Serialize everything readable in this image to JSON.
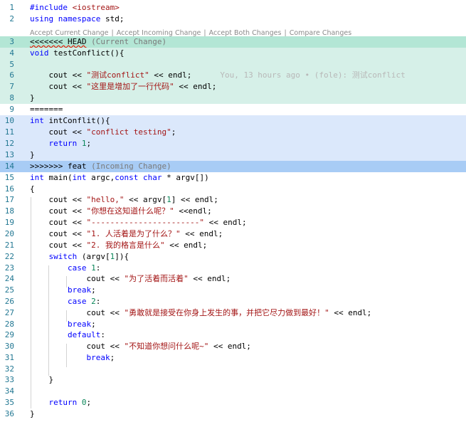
{
  "codelens": {
    "accept_current": "Accept Current Change",
    "accept_incoming": "Accept Incoming Change",
    "accept_both": "Accept Both Changes",
    "compare": "Compare Changes",
    "separator": "|"
  },
  "lines": [
    {
      "n": "1",
      "kind": "normal",
      "tokens": [
        [
          "dir",
          "#include "
        ],
        [
          "str",
          "<iostream>"
        ]
      ]
    },
    {
      "n": "2",
      "kind": "normal",
      "tokens": [
        [
          "kw",
          "using"
        ],
        [
          "",
          " "
        ],
        [
          "kw",
          "namespace"
        ],
        [
          "",
          " std;"
        ]
      ]
    },
    {
      "n": "3",
      "kind": "current-marker",
      "tokens": [
        [
          "squiggle",
          "<<<<<<< HEAD"
        ],
        [
          "muted",
          " (Current Change)"
        ]
      ]
    },
    {
      "n": "4",
      "kind": "current",
      "tokens": [
        [
          "kw",
          "void"
        ],
        [
          "",
          " testConflict(){"
        ]
      ]
    },
    {
      "n": "5",
      "kind": "current",
      "tokens": []
    },
    {
      "n": "6",
      "kind": "current",
      "tokens": [
        [
          "",
          "    cout << "
        ],
        [
          "str",
          "\"测试conflict\""
        ],
        [
          "",
          " << endl;"
        ]
      ],
      "blame": "You, 13 hours ago • (fole): 测试conflict"
    },
    {
      "n": "7",
      "kind": "current",
      "tokens": [
        [
          "",
          "    cout << "
        ],
        [
          "str",
          "\"这里是增加了一行代码\""
        ],
        [
          "",
          " << endl;"
        ]
      ]
    },
    {
      "n": "8",
      "kind": "current",
      "tokens": [
        [
          "",
          "}"
        ]
      ]
    },
    {
      "n": "9",
      "kind": "normal",
      "tokens": [
        [
          "",
          "======="
        ]
      ]
    },
    {
      "n": "10",
      "kind": "incoming",
      "tokens": [
        [
          "kw",
          "int"
        ],
        [
          "",
          " intConflit(){"
        ]
      ]
    },
    {
      "n": "11",
      "kind": "incoming",
      "tokens": [
        [
          "",
          "    cout << "
        ],
        [
          "str",
          "\"conflict testing\""
        ],
        [
          "",
          ";"
        ]
      ]
    },
    {
      "n": "12",
      "kind": "incoming",
      "tokens": [
        [
          "",
          "    "
        ],
        [
          "kw",
          "return"
        ],
        [
          "",
          " "
        ],
        [
          "num",
          "1"
        ],
        [
          "",
          ";"
        ]
      ]
    },
    {
      "n": "13",
      "kind": "incoming",
      "tokens": [
        [
          "",
          "}"
        ]
      ]
    },
    {
      "n": "14",
      "kind": "incoming-marker",
      "tokens": [
        [
          "",
          ">>>>>>> feat"
        ],
        [
          "muted",
          " (Incoming Change)"
        ]
      ]
    },
    {
      "n": "15",
      "kind": "normal",
      "tokens": [
        [
          "kw",
          "int"
        ],
        [
          "",
          " main("
        ],
        [
          "kw",
          "int"
        ],
        [
          "",
          " argc,"
        ],
        [
          "kw",
          "const"
        ],
        [
          "",
          " "
        ],
        [
          "kw",
          "char"
        ],
        [
          "",
          " * argv[])"
        ]
      ]
    },
    {
      "n": "16",
      "kind": "normal",
      "tokens": [
        [
          "",
          "{"
        ]
      ]
    },
    {
      "n": "17",
      "kind": "normal",
      "tokens": [
        [
          "",
          "    cout << "
        ],
        [
          "str",
          "\"hello,\""
        ],
        [
          "",
          " << argv["
        ],
        [
          "num",
          "1"
        ],
        [
          "",
          "] << endl;"
        ]
      ]
    },
    {
      "n": "18",
      "kind": "normal",
      "tokens": [
        [
          "",
          "    cout << "
        ],
        [
          "str",
          "\"你想在这知道什么呢？\""
        ],
        [
          "",
          " <<endl;"
        ]
      ]
    },
    {
      "n": "19",
      "kind": "normal",
      "tokens": [
        [
          "",
          "    cout << "
        ],
        [
          "str",
          "\"-----------------------\""
        ],
        [
          "",
          " << endl;"
        ]
      ]
    },
    {
      "n": "20",
      "kind": "normal",
      "tokens": [
        [
          "",
          "    cout << "
        ],
        [
          "str",
          "\"1. 人活着是为了什么？\""
        ],
        [
          "",
          " << endl;"
        ]
      ]
    },
    {
      "n": "21",
      "kind": "normal",
      "tokens": [
        [
          "",
          "    cout << "
        ],
        [
          "str",
          "\"2. 我的格言是什么\""
        ],
        [
          "",
          " << endl;"
        ]
      ]
    },
    {
      "n": "22",
      "kind": "normal",
      "tokens": [
        [
          "",
          "    "
        ],
        [
          "kw",
          "switch"
        ],
        [
          "",
          " (argv["
        ],
        [
          "num",
          "1"
        ],
        [
          "",
          "]){"
        ]
      ]
    },
    {
      "n": "23",
      "kind": "normal",
      "tokens": [
        [
          "",
          "        "
        ],
        [
          "kw",
          "case"
        ],
        [
          "",
          " "
        ],
        [
          "num",
          "1"
        ],
        [
          "",
          ":"
        ]
      ]
    },
    {
      "n": "24",
      "kind": "normal",
      "tokens": [
        [
          "",
          "            cout << "
        ],
        [
          "str",
          "\"为了活着而活着\""
        ],
        [
          "",
          " << endl;"
        ]
      ]
    },
    {
      "n": "25",
      "kind": "normal",
      "tokens": [
        [
          "",
          "        "
        ],
        [
          "kw",
          "break"
        ],
        [
          "",
          ";"
        ]
      ]
    },
    {
      "n": "26",
      "kind": "normal",
      "tokens": [
        [
          "",
          "        "
        ],
        [
          "kw",
          "case"
        ],
        [
          "",
          " "
        ],
        [
          "num",
          "2"
        ],
        [
          "",
          ":"
        ]
      ]
    },
    {
      "n": "27",
      "kind": "normal",
      "tokens": [
        [
          "",
          "            cout << "
        ],
        [
          "str",
          "\"勇敢就是接受在你身上发生的事，并把它尽力做到最好！\""
        ],
        [
          "",
          " << endl;"
        ]
      ]
    },
    {
      "n": "28",
      "kind": "normal",
      "tokens": [
        [
          "",
          "        "
        ],
        [
          "kw",
          "break"
        ],
        [
          "",
          ";"
        ]
      ]
    },
    {
      "n": "29",
      "kind": "normal",
      "tokens": [
        [
          "",
          "        "
        ],
        [
          "kw",
          "default"
        ],
        [
          "",
          ":"
        ]
      ]
    },
    {
      "n": "30",
      "kind": "normal",
      "tokens": [
        [
          "",
          "            cout << "
        ],
        [
          "str",
          "\"不知道你想问什么呢~\""
        ],
        [
          "",
          " << endl;"
        ]
      ]
    },
    {
      "n": "31",
      "kind": "normal",
      "tokens": [
        [
          "",
          "            "
        ],
        [
          "kw",
          "break"
        ],
        [
          "",
          ";"
        ]
      ]
    },
    {
      "n": "32",
      "kind": "normal",
      "tokens": []
    },
    {
      "n": "33",
      "kind": "normal",
      "tokens": [
        [
          "",
          "    }"
        ]
      ]
    },
    {
      "n": "34",
      "kind": "normal",
      "tokens": []
    },
    {
      "n": "35",
      "kind": "normal",
      "tokens": [
        [
          "",
          "    "
        ],
        [
          "kw",
          "return"
        ],
        [
          "",
          " "
        ],
        [
          "num",
          "0"
        ],
        [
          "",
          ";"
        ]
      ]
    },
    {
      "n": "36",
      "kind": "normal",
      "tokens": [
        [
          "",
          "}"
        ]
      ]
    }
  ]
}
